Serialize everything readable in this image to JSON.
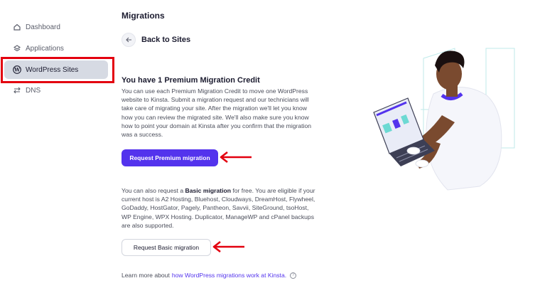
{
  "sidebar": {
    "items": [
      {
        "label": "Dashboard",
        "icon": "home-icon",
        "active": false
      },
      {
        "label": "Applications",
        "icon": "layers-icon",
        "active": false
      },
      {
        "label": "WordPress Sites",
        "icon": "wordpress-icon",
        "active": true
      },
      {
        "label": "DNS",
        "icon": "dns-icon",
        "active": false
      }
    ]
  },
  "header": {
    "title": "Migrations",
    "back_label": "Back to Sites"
  },
  "premium": {
    "title": "You have 1 Premium Migration Credit",
    "description": "You can use each Premium Migration Credit to move one WordPress website to Kinsta. Submit a migration request and our technicians will take care of migrating your site. After the migration we'll let you know how you can review the migrated site. We'll also make sure you know how to point your domain at Kinsta after you confirm that the migration was a success.",
    "button_label": "Request Premium migration"
  },
  "basic": {
    "text_before": "You can also request a ",
    "text_bold": "Basic migration",
    "text_after": " for free. You are eligible if your current host is A2 Hosting, Bluehost, Cloudways, DreamHost, Flywheel, GoDaddy, HostGator, Pagely, Pantheon, Savvii, SiteGround, tsoHost, WP Engine, WPX Hosting. Duplicator, ManageWP and cPanel backups are also supported.",
    "button_label": "Request Basic migration"
  },
  "footer": {
    "learn_prefix": "Learn more about",
    "learn_link": "how WordPress migrations work at Kinsta.",
    "help_glyph": "?"
  },
  "colors": {
    "accent": "#5333ed",
    "annotation_red": "#e3000f",
    "active_nav_bg": "#d6dae3"
  }
}
